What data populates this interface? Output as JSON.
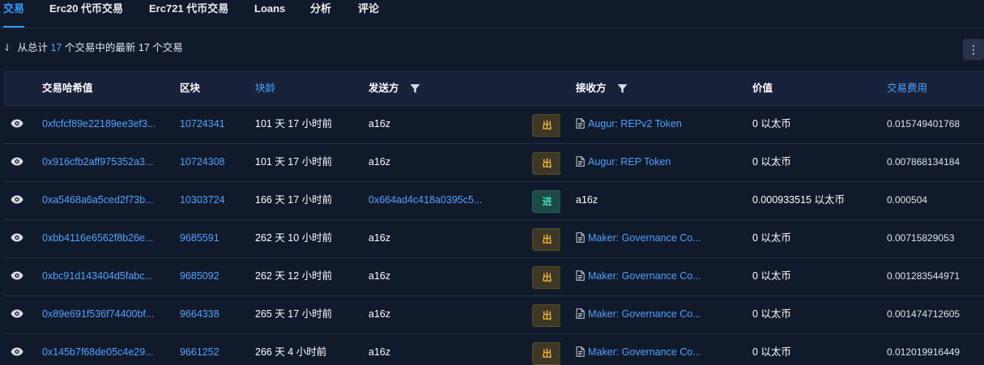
{
  "tabs": [
    {
      "label": "交易",
      "active": true
    },
    {
      "label": "Erc20 代币交易",
      "active": false
    },
    {
      "label": "Erc721 代币交易",
      "active": false
    },
    {
      "label": "Loans",
      "active": false
    },
    {
      "label": "分析",
      "active": false
    },
    {
      "label": "评论",
      "active": false
    }
  ],
  "summary": {
    "prefix": "从总计",
    "total": "17",
    "middle": "个交易中的最新",
    "latest": "17",
    "suffix": "个交易"
  },
  "more_icon": "vertical-dots-icon",
  "table": {
    "headers": {
      "hash": "交易哈希值",
      "block": "区块",
      "age": "块龄",
      "from": "发送方",
      "to": "接收方",
      "value": "价值",
      "fee": "交易费用"
    },
    "rows": [
      {
        "hash": "0xfcfcf89e22189ee3ef3...",
        "block": "10724341",
        "age": "101 天 17 小时前",
        "from": "a16z",
        "from_link": false,
        "direction": "出",
        "to": "Augur: REPv2 Token",
        "to_contract": true,
        "value": "0 以太币",
        "fee": "0.015749401768"
      },
      {
        "hash": "0x916cfb2aff975352a3...",
        "block": "10724308",
        "age": "101 天 17 小时前",
        "from": "a16z",
        "from_link": false,
        "direction": "出",
        "to": "Augur: REP Token",
        "to_contract": true,
        "value": "0 以太币",
        "fee": "0.007868134184"
      },
      {
        "hash": "0xa5468a6a5ced2f73b...",
        "block": "10303724",
        "age": "166 天 17 小时前",
        "from": "0x664ad4c418a0395c5...",
        "from_link": true,
        "direction": "进",
        "to": "a16z",
        "to_contract": false,
        "value": "0.000933515 以太币",
        "fee": "0.000504"
      },
      {
        "hash": "0xbb4116e6562f8b26e...",
        "block": "9685591",
        "age": "262 天 10 小时前",
        "from": "a16z",
        "from_link": false,
        "direction": "出",
        "to": "Maker: Governance Co...",
        "to_contract": true,
        "value": "0 以太币",
        "fee": "0.00715829053"
      },
      {
        "hash": "0xbc91d143404d5fabc...",
        "block": "9685092",
        "age": "262 天 12 小时前",
        "from": "a16z",
        "from_link": false,
        "direction": "出",
        "to": "Maker: Governance Co...",
        "to_contract": true,
        "value": "0 以太币",
        "fee": "0.001283544971"
      },
      {
        "hash": "0x89e691f536f74400bf...",
        "block": "9664338",
        "age": "265 天 17 小时前",
        "from": "a16z",
        "from_link": false,
        "direction": "出",
        "to": "Maker: Governance Co...",
        "to_contract": true,
        "value": "0 以太币",
        "fee": "0.001474712605"
      },
      {
        "hash": "0x145b7f68de05c4e29...",
        "block": "9661252",
        "age": "266 天 4 小时前",
        "from": "a16z",
        "from_link": false,
        "direction": "出",
        "to": "Maker: Governance Co...",
        "to_contract": true,
        "value": "0 以太币",
        "fee": "0.012019916449"
      }
    ]
  },
  "colors": {
    "background": "#111a2b",
    "link": "#4aa3ff",
    "out_badge": "#f2b233",
    "in_badge": "#3fd9b4"
  }
}
